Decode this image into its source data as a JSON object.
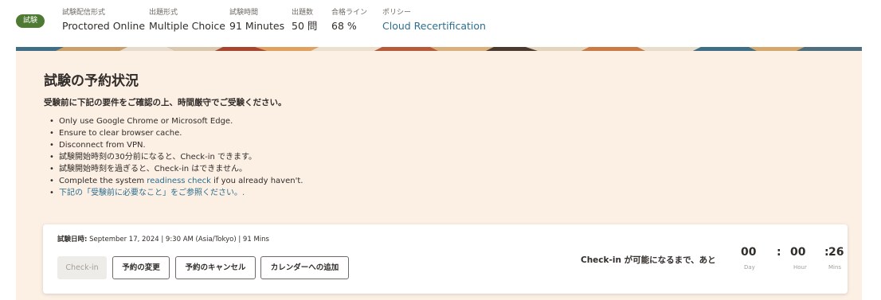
{
  "header": {
    "badge": "試験",
    "fields": [
      {
        "key": "試験配信形式",
        "value": "Proctored Online"
      },
      {
        "key": "出題形式",
        "value": "Multiple Choice"
      },
      {
        "key": "試験時間",
        "value": "91 Minutes"
      },
      {
        "key": "出題数",
        "value": "50 問"
      },
      {
        "key": "合格ライン",
        "value": "68 %"
      },
      {
        "key": "ポリシー",
        "value": "Cloud Recertification"
      }
    ]
  },
  "main": {
    "title": "試験の予約状況",
    "subtitle": "受験前に下記の要件をご確認の上、時間厳守でご受験ください。",
    "requirements": [
      "Only use Google Chrome or Microsoft Edge.",
      "Ensure to clear browser cache.",
      "Disconnect from VPN.",
      "試験開始時刻の30分前になると、Check-in できます。",
      "試験開始時刻を過ぎると、Check-in はできません。"
    ],
    "readiness": {
      "before": "Complete the system ",
      "link": "readiness check",
      "after": " if you already haven't."
    },
    "see_below": "下記の「受験前に必要なこと」をご参照ください。."
  },
  "booking": {
    "date_label": "試験日時:",
    "date_value": " September 17, 2024 | 9:30 AM (Asia/Tokyo) | 91 Mins",
    "buttons": {
      "checkin": "Check-in",
      "change": "予約の変更",
      "cancel": "予約のキャンセル",
      "calendar": "カレンダーへの追加"
    },
    "countdown_label": "Check-in が可能になるまで、あと",
    "countdown": {
      "day": "00",
      "hour": "00",
      "min": "26",
      "day_unit": "Day",
      "hour_unit": "Hour",
      "min_unit": "Mins",
      "sep": ":"
    }
  }
}
